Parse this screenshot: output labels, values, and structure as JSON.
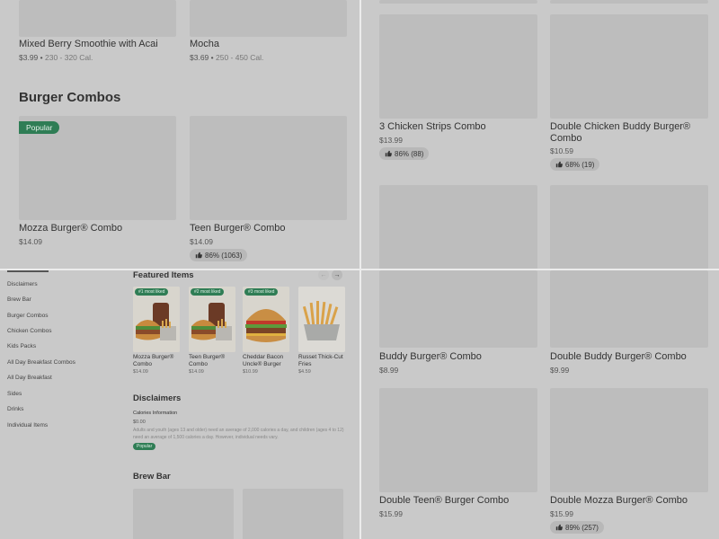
{
  "q1": {
    "items": [
      {
        "name": "Mixed Berry Smoothie with Acai",
        "price": "$3.99",
        "cal": "230 - 320 Cal."
      },
      {
        "name": "Mocha",
        "price": "$3.69",
        "cal": "250 - 450 Cal."
      }
    ],
    "section_title": "Burger Combos",
    "popular_badge": "Popular",
    "combos": [
      {
        "name": "Mozza Burger® Combo",
        "price": "$14.09"
      },
      {
        "name": "Teen Burger® Combo",
        "price": "$14.09",
        "rating": "86% (1063)"
      }
    ]
  },
  "q2": {
    "items": [
      {
        "name": "3 Chicken Strips Combo",
        "price": "$13.99",
        "rating": "86% (88)"
      },
      {
        "name": "Double Chicken Buddy Burger® Combo",
        "price": "$10.59",
        "rating": "68% (19)"
      }
    ]
  },
  "q3": {
    "sidebar": [
      "Disclaimers",
      "Brew Bar",
      "Burger Combos",
      "Chicken Combos",
      "Kids Packs",
      "All Day Breakfast Combos",
      "All Day Breakfast",
      "Sides",
      "Drinks",
      "Individual Items"
    ],
    "featured_title": "Featured Items",
    "prev_arrow": "←",
    "next_arrow": "→",
    "featured": [
      {
        "badge": "#1 most liked",
        "name": "Mozza Burger® Combo",
        "price": "$14.09"
      },
      {
        "badge": "#2 most liked",
        "name": "Teen Burger® Combo",
        "price": "$14.09"
      },
      {
        "badge": "#3 most liked",
        "name": "Cheddar Bacon Uncle® Burger",
        "price": "$10.99"
      },
      {
        "badge": "",
        "name": "Russet Thick-Cut Fries",
        "price": "$4.59"
      }
    ],
    "disclaimers_title": "Disclaimers",
    "calories_title": "Calories Information",
    "calories_price": "$0.00",
    "calories_text": "Adults and youth (ages 13 and older) need an average of 2,000 calories a day, and children (ages 4 to 12) need an average of 1,500 calories a day. However, individual needs vary.",
    "popular_badge": "Popular",
    "brew_title": "Brew Bar"
  },
  "q4": {
    "items": [
      {
        "name": "Buddy Burger® Combo",
        "price": "$8.99"
      },
      {
        "name": "Double Buddy Burger® Combo",
        "price": "$9.99"
      },
      {
        "name": "Double Teen® Burger Combo",
        "price": "$15.99"
      },
      {
        "name": "Double Mozza Burger® Combo",
        "price": "$15.99",
        "rating": "89% (257)"
      }
    ]
  }
}
